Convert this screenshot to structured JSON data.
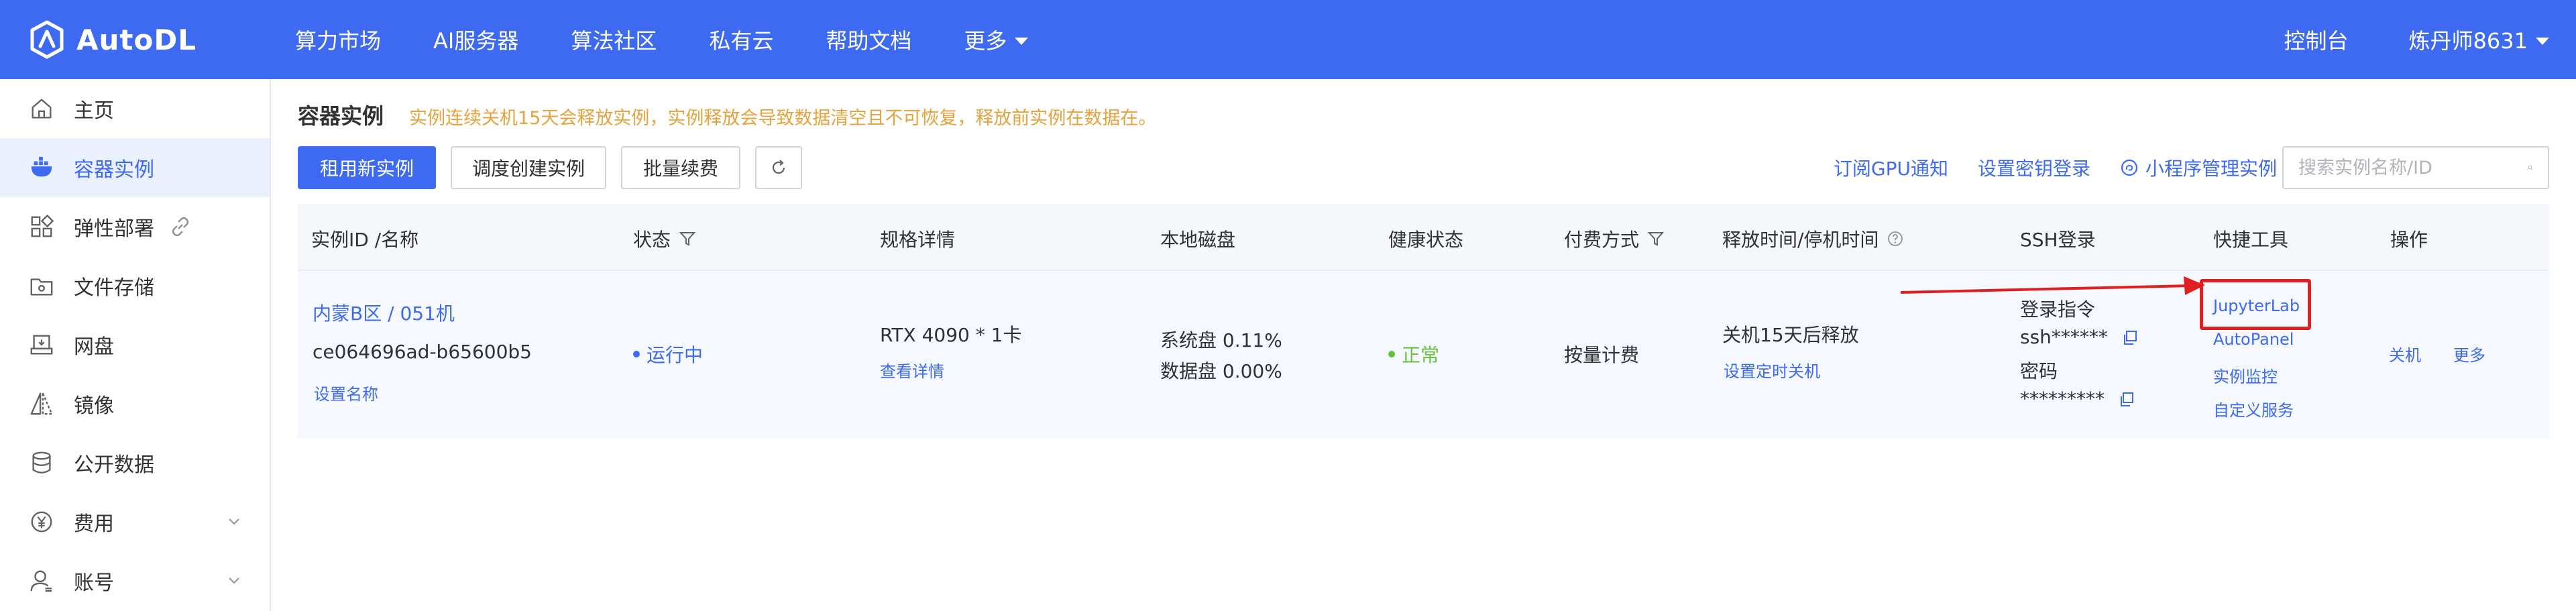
{
  "brand": {
    "name": "AutoDL"
  },
  "nav": {
    "items": [
      "算力市场",
      "AI服务器",
      "算法社区",
      "私有云",
      "帮助文档"
    ],
    "more": "更多",
    "console": "控制台",
    "user": "炼丹师8631"
  },
  "sidebar": {
    "items": [
      {
        "label": "主页",
        "icon": "home-icon"
      },
      {
        "label": "容器实例",
        "icon": "container-icon",
        "active": true
      },
      {
        "label": "弹性部署",
        "icon": "grid-icon",
        "extra_icon": "link-icon"
      },
      {
        "label": "文件存储",
        "icon": "folder-icon"
      },
      {
        "label": "网盘",
        "icon": "drive-icon"
      },
      {
        "label": "镜像",
        "icon": "mirror-icon"
      },
      {
        "label": "公开数据",
        "icon": "database-icon"
      },
      {
        "label": "费用",
        "icon": "yen-icon",
        "expandable": true
      },
      {
        "label": "账号",
        "icon": "user-icon",
        "expandable": true
      }
    ]
  },
  "page": {
    "title": "容器实例",
    "notice": "实例连续关机15天会释放实例，实例释放会导致数据清空且不可恢复，释放前实例在数据在。"
  },
  "toolbar": {
    "rent_new": "租用新实例",
    "tune_create": "调度创建实例",
    "batch_renew": "批量续费",
    "subscribe_gpu": "订阅GPU通知",
    "set_key_login": "设置密钥登录",
    "mini_program": "小程序管理实例",
    "search_placeholder": "搜索实例名称/ID"
  },
  "table": {
    "headers": {
      "id_name": "实例ID /名称",
      "status": "状态",
      "spec": "规格详情",
      "disk": "本地磁盘",
      "health": "健康状态",
      "billing": "付费方式",
      "release": "释放时间/停机时间",
      "ssh": "SSH登录",
      "tools": "快捷工具",
      "ops": "操作"
    },
    "row": {
      "region": "内蒙B区 / 051机",
      "instance_id": "ce064696ad-b65600b5",
      "set_name": "设置名称",
      "status": "运行中",
      "spec": "RTX 4090 * 1卡",
      "spec_detail": "查看详情",
      "system_disk": "系统盘 0.11%",
      "data_disk": "数据盘 0.00%",
      "health": "正常",
      "billing": "按量计费",
      "release": "关机15天后释放",
      "set_timer": "设置定时关机",
      "ssh_cmd_label": "登录指令",
      "ssh_cmd": "ssh******",
      "password_label": "密码",
      "password": "*********",
      "tools": [
        "JupyterLab",
        "AutoPanel",
        "实例监控",
        "自定义服务"
      ],
      "op_shutdown": "关机",
      "op_more": "更多"
    }
  },
  "colors": {
    "primary": "#3d6af0",
    "warning": "#e6a23c",
    "success": "#67c23a",
    "annotation": "#e02020"
  }
}
